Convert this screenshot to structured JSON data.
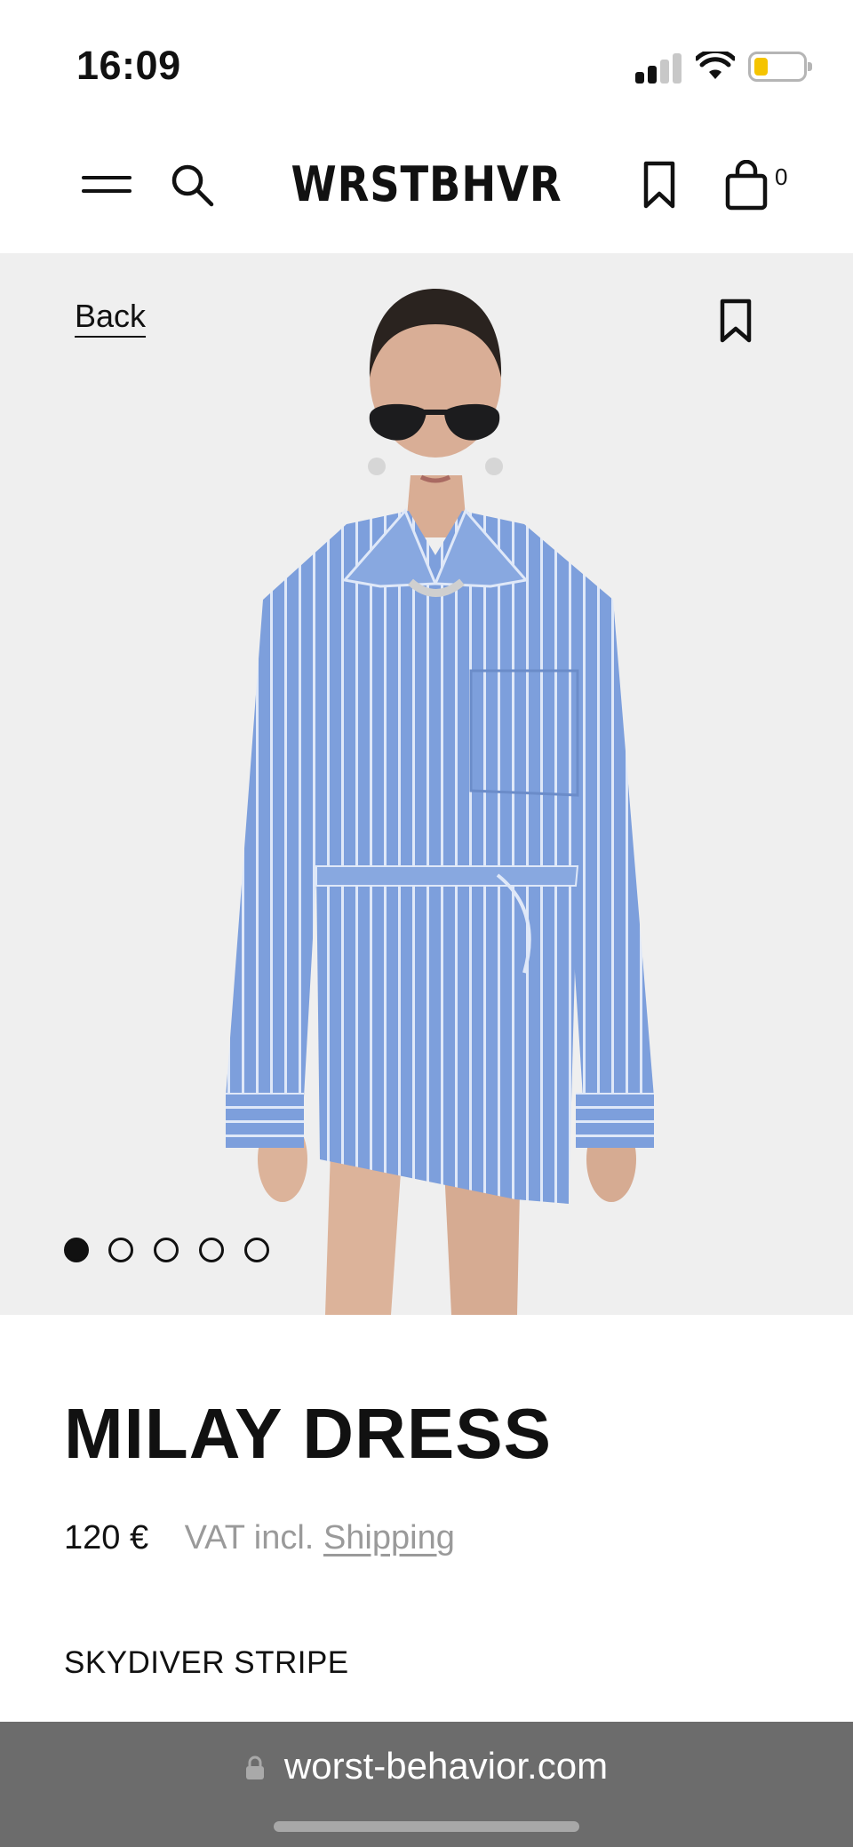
{
  "status_bar": {
    "time": "16:09",
    "signal_bars": 2,
    "battery_level": 0.25,
    "battery_color": "#f5c400"
  },
  "header": {
    "brand": "WRSTBHVR",
    "cart_count": "0",
    "icons": [
      "menu-icon",
      "search-icon",
      "bookmark-icon",
      "bag-icon"
    ]
  },
  "gallery": {
    "back_label": "Back",
    "image_count": 5,
    "active_index": 0,
    "description_icons": [
      "bookmark-icon"
    ]
  },
  "product": {
    "title": "MILAY DRESS",
    "price": "120 €",
    "vat_label": "VAT incl.",
    "shipping_label": "Shipping",
    "color_name": "SKYDIVER STRIPE"
  },
  "browser": {
    "url": "worst-behavior.com"
  },
  "colors": {
    "hero_background": "#efefef",
    "shirt_blue": "#7d9fdc",
    "browser_bar": "#6c6c6c",
    "muted_text": "#9a9a9a"
  }
}
